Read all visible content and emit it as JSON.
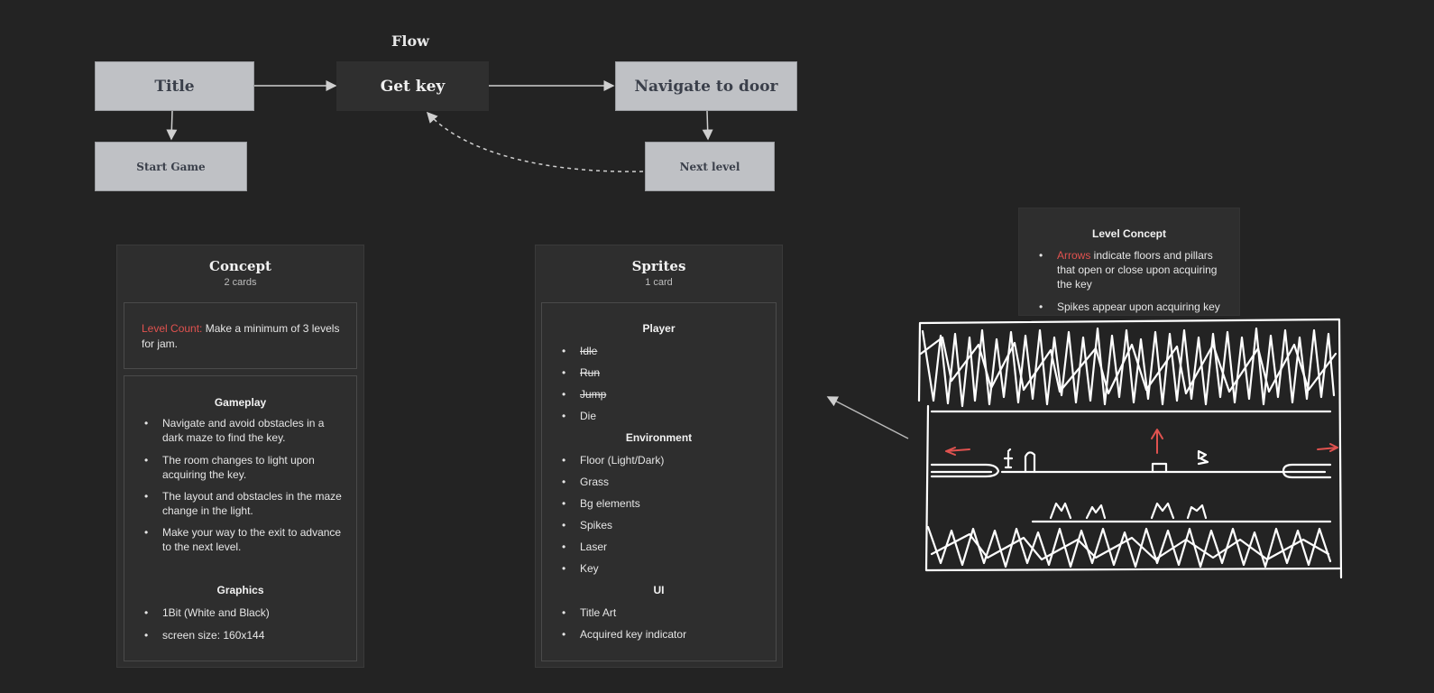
{
  "flow": {
    "heading": "Flow",
    "boxes": {
      "title": "Title",
      "get_key": "Get key",
      "navigate": "Navigate to door",
      "start_game": "Start Game",
      "next_level": "Next level"
    }
  },
  "concept": {
    "title": "Concept",
    "subtitle": "2 cards",
    "level_count_label": "Level Count:",
    "level_count_text": " Make a minimum of 3 levels for jam.",
    "gameplay_heading": "Gameplay",
    "gameplay_items": [
      "Navigate and avoid obstacles in a dark maze to find the key.",
      "The room changes to light upon acquiring the key.",
      "The layout and obstacles in the maze change in the light.",
      "Make your way to the exit to advance to the next level."
    ],
    "graphics_heading": "Graphics",
    "graphics_items": [
      "1Bit (White and Black)",
      "screen size: 160x144"
    ]
  },
  "sprites": {
    "title": "Sprites",
    "subtitle": "1 card",
    "player_heading": "Player",
    "player_items": [
      "Idle",
      "Run",
      "Jump",
      "Die"
    ],
    "environment_heading": "Environment",
    "environment_items": [
      "Floor (Light/Dark)",
      "Grass",
      "Bg elements",
      "Spikes",
      "Laser",
      "Key"
    ],
    "ui_heading": "UI",
    "ui_items": [
      "Title Art",
      "Acquired key indicator"
    ]
  },
  "level_concept": {
    "title": "Level Concept",
    "arrows_word": "Arrows",
    "arrows_text": " indicate floors and pillars that open or close upon acquiring the key",
    "spikes_text": "Spikes appear upon acquiring key"
  },
  "colors": {
    "background": "#232323",
    "box_light": "#bfc1c5",
    "box_dark": "#2f2f2f",
    "accent_red": "#e0524f"
  }
}
